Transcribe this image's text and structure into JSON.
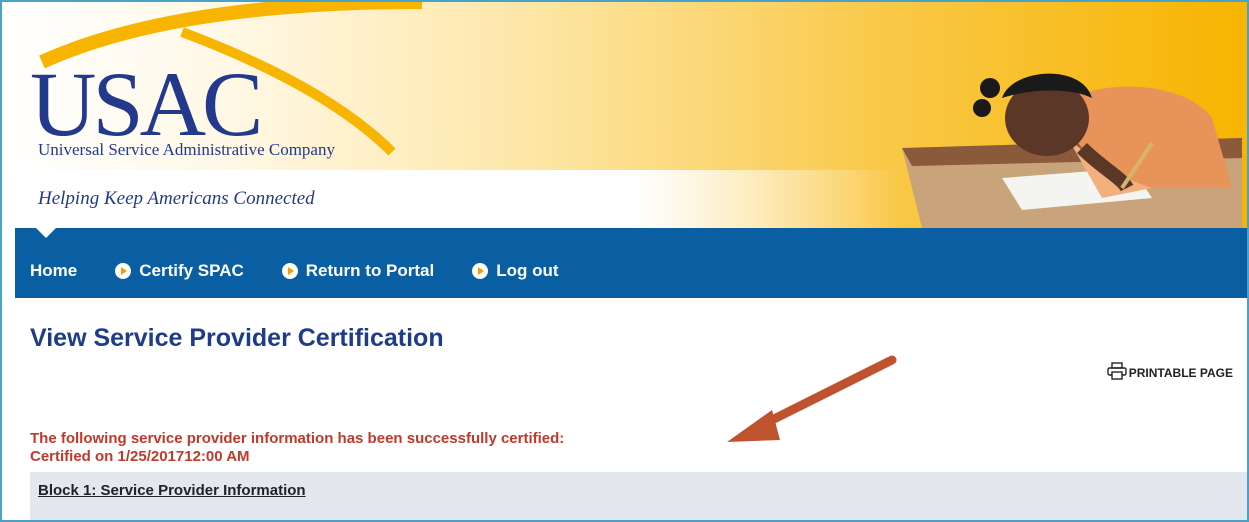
{
  "brand": {
    "logo_text": "USAC",
    "logo_subtitle": "Universal Service Administrative Company",
    "tagline": "Helping Keep Americans Connected",
    "colors": {
      "navy": "#233a8c",
      "nav_blue": "#0a5fa3",
      "gold": "#f7b400",
      "message_red": "#c0392b"
    }
  },
  "nav": {
    "items": [
      {
        "label": "Home",
        "icon": ""
      },
      {
        "label": "Certify SPAC",
        "icon": "arrow-circle-icon"
      },
      {
        "label": "Return to Portal",
        "icon": "arrow-circle-icon"
      },
      {
        "label": "Log out",
        "icon": "arrow-circle-icon"
      }
    ]
  },
  "page": {
    "title": "View Service Provider Certification",
    "printable_label": "PRINTABLE PAGE",
    "message_line1": "The following service provider information has been successfully certified:",
    "message_line2": "Certified on 1/25/201712:00 AM",
    "block_title": "Block 1: Service Provider Information"
  }
}
